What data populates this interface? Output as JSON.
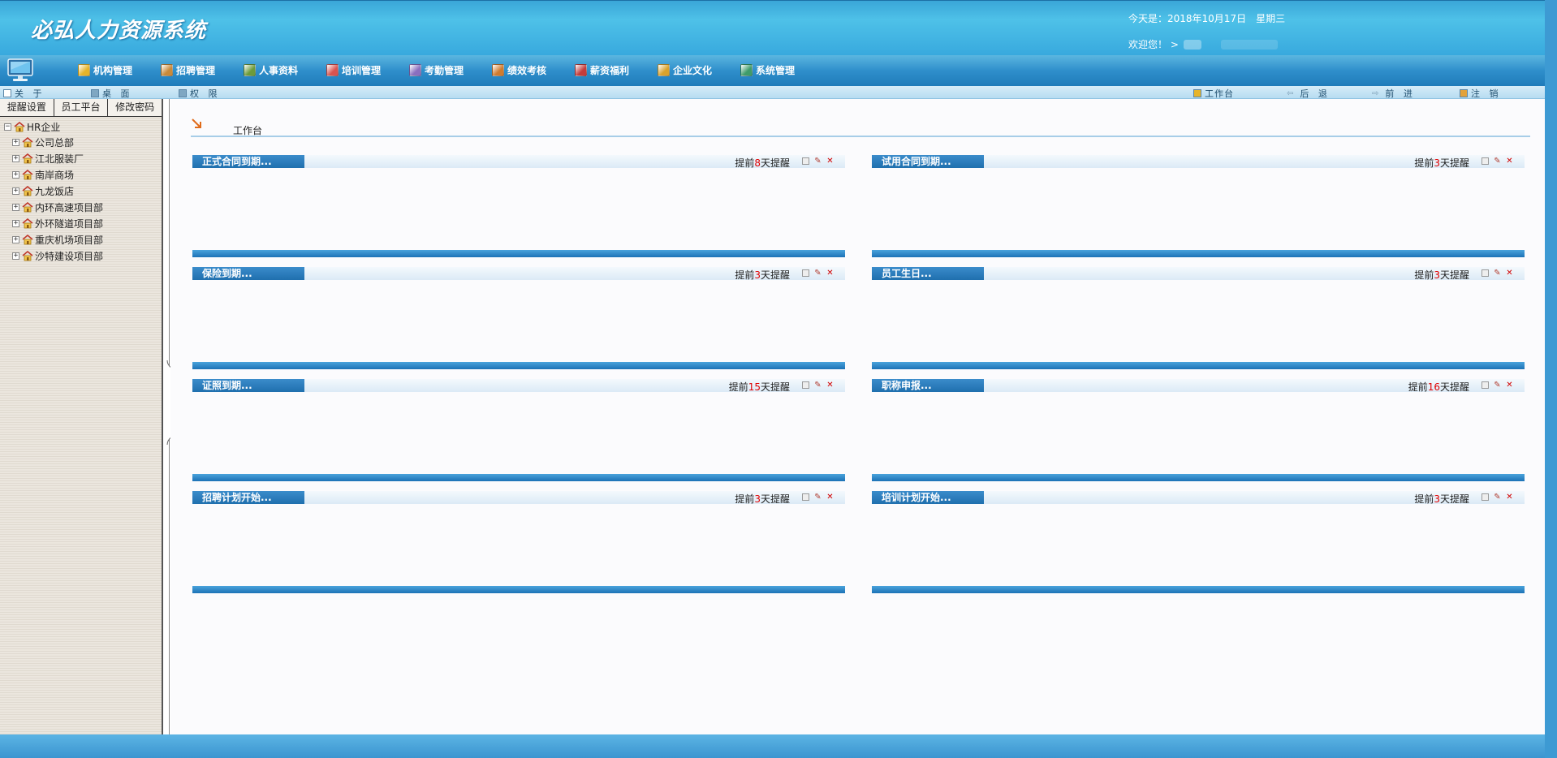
{
  "header": {
    "logo": "必弘人力资源系统",
    "date_line": "今天是：2018年10月17日　星期三",
    "welcome_label": "欢迎您！ >"
  },
  "mainnav": {
    "items": [
      {
        "label": "机构管理",
        "icon": "org-icon",
        "color": "#e6b42a"
      },
      {
        "label": "招聘管理",
        "icon": "recruit-icon",
        "color": "#c98a3a"
      },
      {
        "label": "人事资料",
        "icon": "personnel-icon",
        "color": "#6c9b3b"
      },
      {
        "label": "培训管理",
        "icon": "training-icon",
        "color": "#d9534f"
      },
      {
        "label": "考勤管理",
        "icon": "attendance-icon",
        "color": "#8a6fbf"
      },
      {
        "label": "绩效考核",
        "icon": "performance-icon",
        "color": "#d07b2e"
      },
      {
        "label": "薪资福利",
        "icon": "salary-icon",
        "color": "#c43c3c"
      },
      {
        "label": "企业文化",
        "icon": "culture-icon",
        "color": "#d9a22b"
      },
      {
        "label": "系统管理",
        "icon": "system-icon",
        "color": "#3f9c6a"
      }
    ]
  },
  "subbar": {
    "about": "关 于",
    "desktop": "桌 面",
    "rights": "权 限",
    "workbench": "工作台",
    "back": "后 退",
    "forward": "前 进",
    "logout": "注 销"
  },
  "sidebar": {
    "tabs": [
      "提醒设置",
      "员工平台",
      "修改密码"
    ],
    "root": "HR企业",
    "nodes": [
      "公司总部",
      "江北服装厂",
      "南岸商场",
      "九龙饭店",
      "内环高速项目部",
      "外环隧道项目部",
      "重庆机场项目部",
      "沙特建设项目部"
    ]
  },
  "content": {
    "breadcrumb": "工作台",
    "panels": [
      {
        "title": "正式合同到期...",
        "pre": "提前",
        "days": "8",
        "post": "天提醒"
      },
      {
        "title": "试用合同到期...",
        "pre": "提前",
        "days": "3",
        "post": "天提醒"
      },
      {
        "title": "保险到期...",
        "pre": "提前",
        "days": "3",
        "post": "天提醒"
      },
      {
        "title": "员工生日...",
        "pre": "提前",
        "days": "3",
        "post": "天提醒"
      },
      {
        "title": "证照到期...",
        "pre": "提前",
        "days": "15",
        "post": "天提醒"
      },
      {
        "title": "职称申报...",
        "pre": "提前",
        "days": "16",
        "post": "天提醒"
      },
      {
        "title": "招聘计划开始...",
        "pre": "提前",
        "days": "3",
        "post": "天提醒"
      },
      {
        "title": "培训计划开始...",
        "pre": "提前",
        "days": "3",
        "post": "天提醒"
      }
    ]
  },
  "colors": {
    "header_blue": "#3aa6d8",
    "nav_blue": "#2f8fcb",
    "panel_title_blue": "#1f6fae",
    "reminder_red": "#e00000"
  }
}
